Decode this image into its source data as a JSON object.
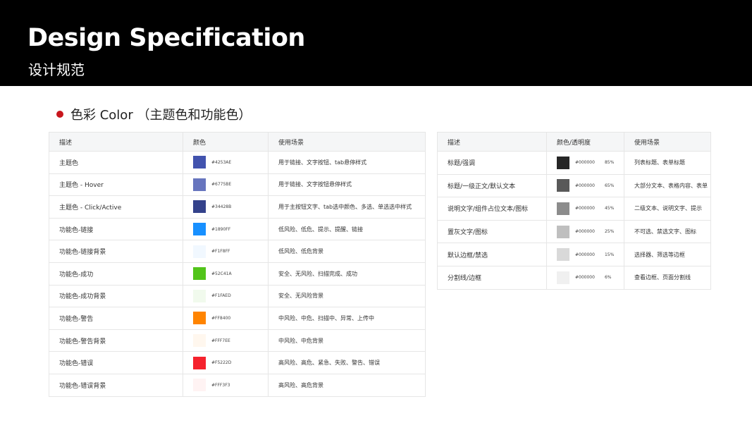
{
  "header": {
    "title": "Design Specification",
    "subtitle": "设计规范"
  },
  "section": {
    "heading": "色彩 Color （主题色和功能色）",
    "bullet_color": "#C8161D"
  },
  "left_table": {
    "headers": [
      "描述",
      "颜色",
      "使用场景"
    ],
    "rows": [
      {
        "desc": "主题色",
        "color": "#4253AE",
        "label": "#4253AE",
        "usage": "用于链接、文字按钮、tab悬停样式"
      },
      {
        "desc": "主题色 - Hover",
        "color": "#6775BE",
        "label": "#6775BE",
        "usage": "用于链接、文字按钮悬停样式"
      },
      {
        "desc": "主题色 - Click/Active",
        "color": "#34428B",
        "label": "#34428B",
        "usage": "用于主按钮文字、tab选中颜色、多选、单选选中样式"
      },
      {
        "desc": "功能色-链接",
        "color": "#1890FF",
        "label": "#1890FF",
        "usage": "低风险、低危、提示、提醒、链接"
      },
      {
        "desc": "功能色-链接背景",
        "color": "#F1F8FF",
        "label": "#F1F8FF",
        "usage": "低风险、低危背景"
      },
      {
        "desc": "功能色-成功",
        "color": "#52C41A",
        "label": "#52C41A",
        "usage": "安全、无风险、扫描完成、成功"
      },
      {
        "desc": "功能色-成功背景",
        "color": "#F1FAED",
        "label": "#F1FAED",
        "usage": "安全、无风险背景"
      },
      {
        "desc": "功能色-警告",
        "color": "#FF8400",
        "label": "#FF8400",
        "usage": "中风险、中危、扫描中、异常、上传中"
      },
      {
        "desc": "功能色-警告背景",
        "color": "#FFF7EE",
        "label": "#FFF7EE",
        "usage": "中风险、中危背景"
      },
      {
        "desc": "功能色-错误",
        "color": "#F5222D",
        "label": "#F5222D",
        "usage": "高风险、高危、紧急、失败、警告、错误"
      },
      {
        "desc": "功能色-错误背景",
        "color": "#FFF3F3",
        "label": "#FFF3F3",
        "usage": "高风险、高危背景"
      }
    ]
  },
  "right_table": {
    "headers": [
      "描述",
      "颜色/透明度",
      "使用场景"
    ],
    "rows": [
      {
        "desc": "标题/强调",
        "color": "#262626",
        "hex": "#000000",
        "opacity": "85%",
        "usage": "列表标题、表单标题"
      },
      {
        "desc": "标题/一级正文/默认文本",
        "color": "#595959",
        "hex": "#000000",
        "opacity": "65%",
        "usage": "大部分文本、表格内容、表单"
      },
      {
        "desc": "说明文字/组件占位文本/图标",
        "color": "#8C8C8C",
        "hex": "#000000",
        "opacity": "45%",
        "usage": "二级文本、说明文字、提示"
      },
      {
        "desc": "置灰文字/图标",
        "color": "#BFBFBF",
        "hex": "#000000",
        "opacity": "25%",
        "usage": "不可选、禁选文字、图标"
      },
      {
        "desc": "默认边框/禁选",
        "color": "#D9D9D9",
        "hex": "#000000",
        "opacity": "15%",
        "usage": "选择器、筛选等边框"
      },
      {
        "desc": "分割线/边框",
        "color": "#F0F0F0",
        "hex": "#000000",
        "opacity": "6%",
        "usage": "查看边框、页面分割线"
      }
    ]
  }
}
